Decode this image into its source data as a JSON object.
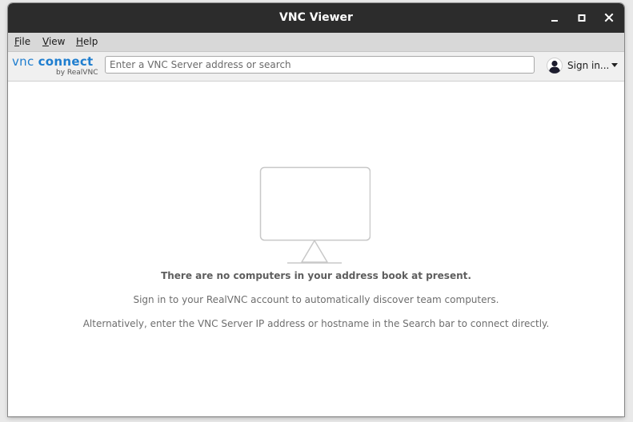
{
  "window": {
    "title": "VNC Viewer"
  },
  "menu": {
    "file": {
      "mnemonic": "F",
      "rest": "ile"
    },
    "view": {
      "mnemonic": "V",
      "rest": "iew"
    },
    "help": {
      "mnemonic": "H",
      "rest": "elp"
    }
  },
  "toolbar": {
    "logo": {
      "vnc": "vnc",
      "connect": "connect",
      "sub": "by RealVNC"
    },
    "search_placeholder": "Enter a VNC Server address or search",
    "search_value": "",
    "signin_label": "Sign in..."
  },
  "empty_state": {
    "heading": "There are no computers in your address book at present.",
    "line1": "Sign in to your RealVNC account to automatically discover team computers.",
    "line2": "Alternatively, enter the VNC Server IP address or hostname in the Search bar to connect directly."
  },
  "icons": {
    "minimize": "minimize-icon",
    "maximize": "maximize-icon",
    "close": "close-icon",
    "user": "user-avatar-icon",
    "dropdown": "chevron-down-icon",
    "monitor": "monitor-icon"
  },
  "colors": {
    "titlebar": "#2c2c2c",
    "brand_blue": "#1f7ecf",
    "menubar": "#d8d8d8",
    "toolbar": "#f0f0f0",
    "monitor_stroke": "#c8c8c8"
  }
}
